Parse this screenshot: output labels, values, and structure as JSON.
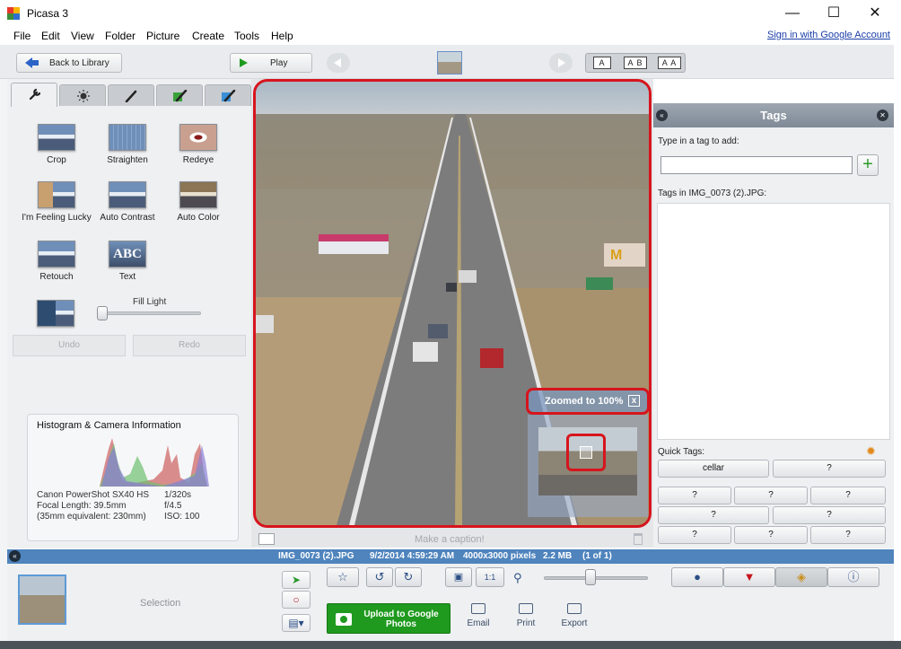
{
  "window": {
    "title": "Picasa 3",
    "minimize_glyph": "—",
    "maximize_glyph": "☐",
    "close_glyph": "✕"
  },
  "menu": {
    "items": [
      "File",
      "Edit",
      "View",
      "Folder",
      "Picture",
      "Create",
      "Tools",
      "Help"
    ],
    "sign_in": "Sign in with Google Account"
  },
  "toolbar": {
    "back_label": "Back to Library",
    "play_label": "Play",
    "caption_modes": [
      "A",
      "A B",
      "A A"
    ]
  },
  "left_panel": {
    "tabs": [
      "wrench-icon",
      "sun-icon",
      "brush-icon",
      "green-brush-icon",
      "blue-brush-icon"
    ],
    "tools": [
      {
        "label": "Crop"
      },
      {
        "label": "Straighten"
      },
      {
        "label": "Redeye"
      },
      {
        "label": "I'm Feeling Lucky"
      },
      {
        "label": "Auto Contrast"
      },
      {
        "label": "Auto Color"
      },
      {
        "label": "Retouch"
      },
      {
        "label": "Text"
      }
    ],
    "text_thumb": "ABC",
    "fill_light_label": "Fill Light",
    "fill_light_value": 0,
    "undo_label": "Undo",
    "redo_label": "Redo",
    "histogram": {
      "title": "Histogram & Camera Information",
      "camera": "Canon PowerShot SX40 HS",
      "focal_length": "Focal Length: 39.5mm",
      "equivalent": "(35mm equivalent: 230mm)",
      "shutter": "1/320s",
      "aperture": "f/4.5",
      "iso": "ISO: 100"
    }
  },
  "photo": {
    "zoom_text": "Zoomed to 100%",
    "zoom_close": "x",
    "caption_placeholder": "Make a caption!"
  },
  "tags": {
    "title": "Tags",
    "collapse_glyph": "«",
    "close_glyph": "✕",
    "input_label": "Type in a tag to add:",
    "input_value": "",
    "add_glyph": "+",
    "tags_in_label": "Tags in IMG_0073 (2).JPG:",
    "quick_tags_label": "Quick Tags:",
    "quick_tags": [
      "cellar",
      "?",
      "?",
      "?",
      "?",
      "?",
      "?",
      "?",
      "?",
      "?"
    ]
  },
  "status": {
    "filename": "IMG_0073 (2).JPG",
    "datetime": "9/2/2014 4:59:29 AM",
    "dimensions": "4000x3000 pixels",
    "size": "2.2 MB",
    "position": "(1 of 1)",
    "collapse_glyph": "«"
  },
  "tray": {
    "selection_label": "Selection",
    "upload_label": "Upload to Google Photos",
    "actions": [
      "Email",
      "Print",
      "Export"
    ],
    "fit_label": "1:1",
    "zoom_level": 0.45
  },
  "colors": {
    "accent_red": "#d7141d",
    "status_blue": "#4f84bd",
    "upload_green": "#1f9a1f",
    "link_blue": "#1a3ea8"
  }
}
